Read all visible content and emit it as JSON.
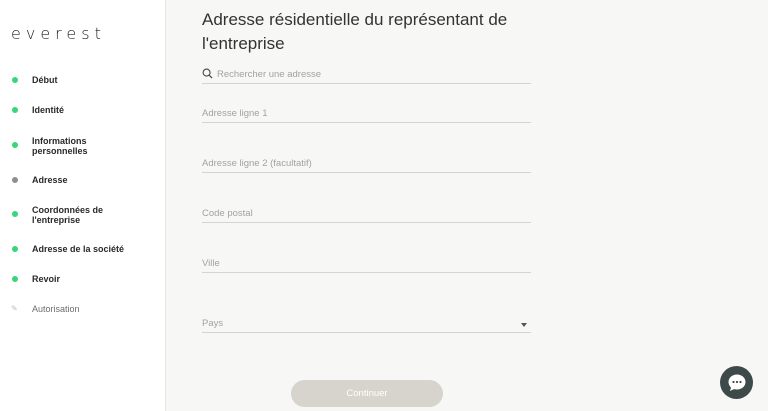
{
  "brand": {
    "logo_text": "everest"
  },
  "steps": [
    {
      "label": "Début",
      "state": "done"
    },
    {
      "label": "Identité",
      "state": "done"
    },
    {
      "label": "Informations personnelles",
      "state": "done"
    },
    {
      "label": "Adresse",
      "state": "current"
    },
    {
      "label": "Coordonnées de l'entreprise",
      "state": "done"
    },
    {
      "label": "Adresse de la société",
      "state": "done"
    },
    {
      "label": "Revoir",
      "state": "done"
    },
    {
      "label": "Autorisation",
      "state": "todo"
    }
  ],
  "form": {
    "title": "Adresse résidentielle du représentant de l'entreprise",
    "search_placeholder": "Rechercher une adresse",
    "address1_placeholder": "Adresse ligne 1",
    "address2_placeholder": "Adresse ligne 2 (facultatif)",
    "postal_placeholder": "Code postal",
    "city_placeholder": "Ville",
    "country_placeholder": "Pays",
    "continue_label": "Continuer"
  },
  "colors": {
    "done": "#37d67a",
    "current": "#8e8e8e",
    "button": "#d7d4cd",
    "chat": "#3e4a4a"
  },
  "icons": {
    "search": "search-icon",
    "dropdown": "chevron-down-icon",
    "chat": "chat-bubble-icon"
  }
}
